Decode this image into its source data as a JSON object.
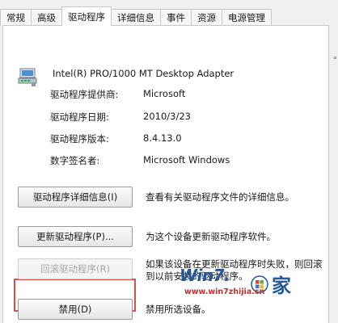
{
  "tabs": [
    {
      "label": "常规"
    },
    {
      "label": "高级"
    },
    {
      "label": "驱动程序"
    },
    {
      "label": "详细信息"
    },
    {
      "label": "事件"
    },
    {
      "label": "资源"
    },
    {
      "label": "电源管理"
    }
  ],
  "active_tab": "驱动程序",
  "device": {
    "icon": "network-adapter-icon",
    "name": "Intel(R) PRO/1000 MT Desktop Adapter"
  },
  "properties": [
    {
      "label": "驱动程序提供商:",
      "value": "Microsoft"
    },
    {
      "label": "驱动程序日期:",
      "value": "2010/3/23"
    },
    {
      "label": "驱动程序版本:",
      "value": "8.4.13.0"
    },
    {
      "label": "数字签名者:",
      "value": "Microsoft Windows"
    }
  ],
  "actions": [
    {
      "label": "驱动程序详细信息(I)",
      "description": "查看有关驱动程序文件的详细信息。",
      "enabled": true
    },
    {
      "label": "更新驱动程序(P)...",
      "description": "为这个设备更新驱动程序软件。",
      "enabled": true
    },
    {
      "label": "回滚驱动程序(R)",
      "description": "如果该设备在更新驱动程序时失败，则回滚到以前安装的驱动程序。",
      "enabled": false
    },
    {
      "label": "禁用(D)",
      "description": "禁用所选设备。",
      "enabled": true
    }
  ],
  "watermark": {
    "text": "Win7.",
    "url": "www.win7zhijia.cn",
    "symbol": "家"
  },
  "colors": {
    "highlight": "#e34b4b",
    "watermark_text": "#24589b",
    "watermark_url": "#d12a2a"
  }
}
